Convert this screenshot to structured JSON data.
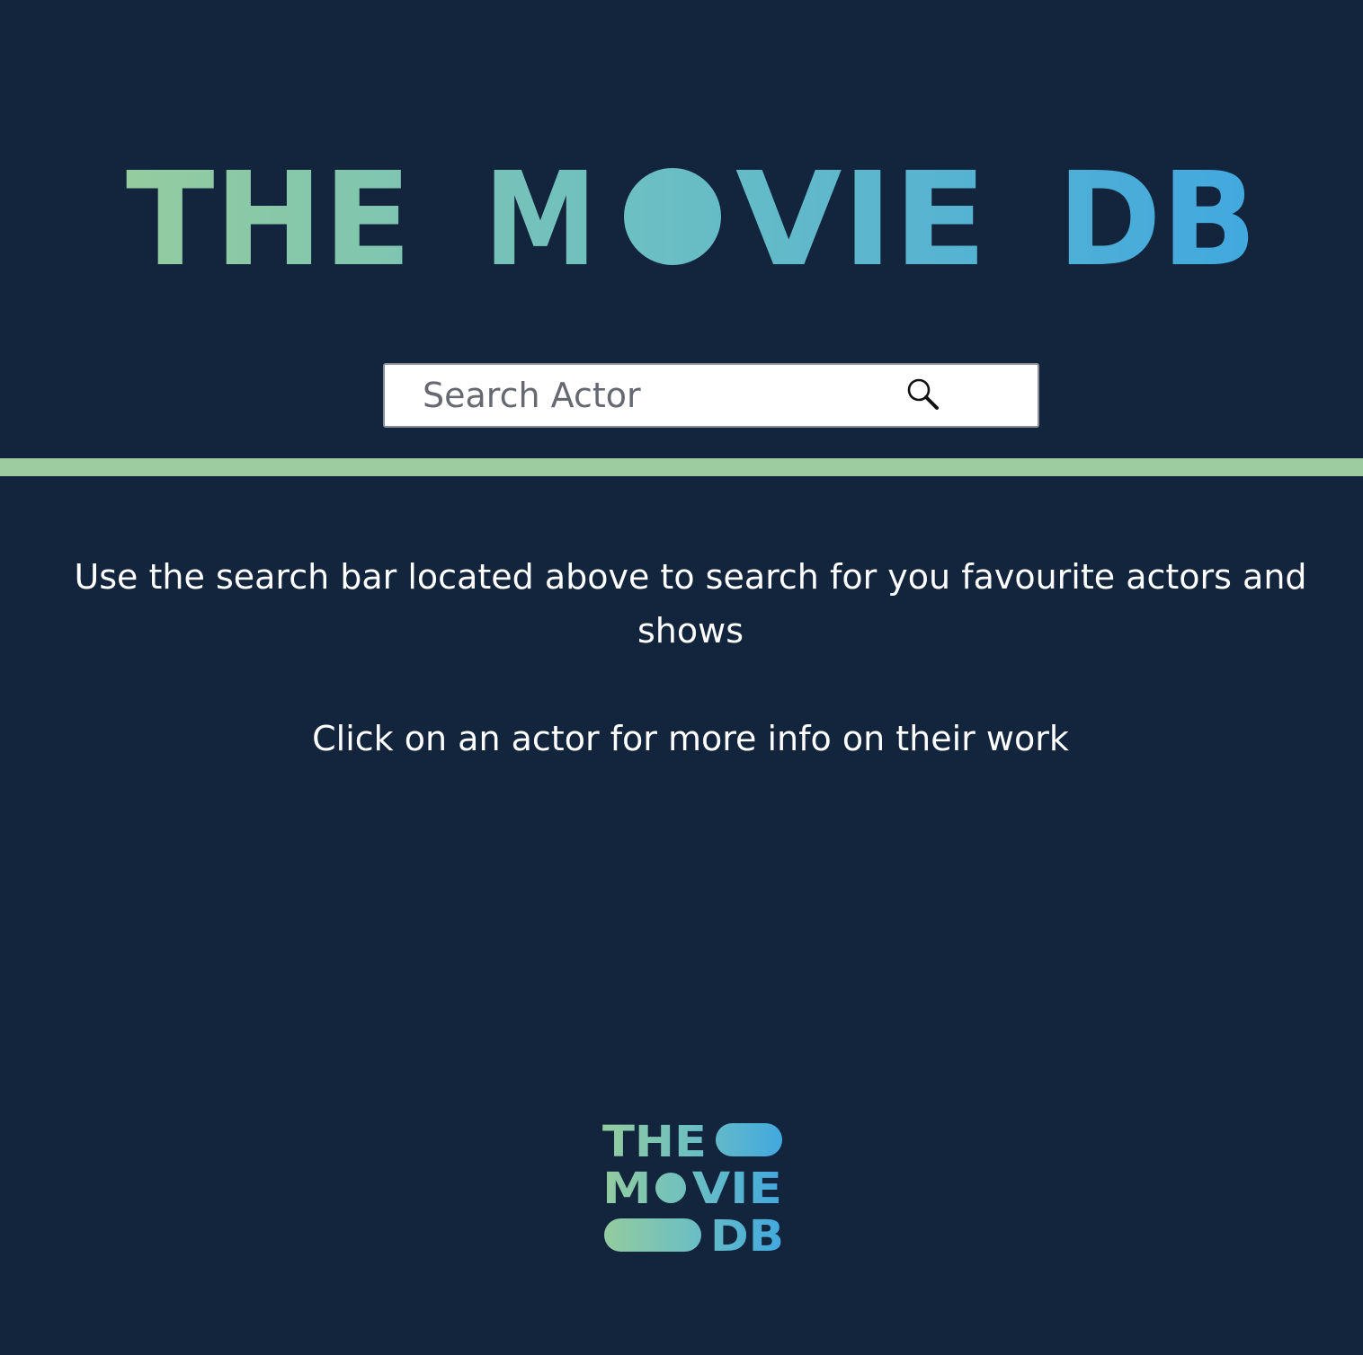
{
  "header": {
    "logo_text": "THE MOVIE DB",
    "logo_gradient": [
      "#92cba0",
      "#6cbfc4",
      "#43a9de"
    ]
  },
  "search": {
    "placeholder": "Search Actor",
    "value": "",
    "icon": "search-icon"
  },
  "divider": {
    "color": "#9ccc9f"
  },
  "main": {
    "instruction_1": "Use the search bar located above to search for you favourite actors and shows",
    "instruction_2": "Click on an actor for more info on their work"
  },
  "footer": {
    "logo_text": "THE MOVIE DB",
    "logo_line1": "THE",
    "logo_line2": "MOVIE",
    "logo_line3": "DB"
  },
  "colors": {
    "background": "#13243d",
    "text": "#ffffff",
    "accent_green": "#92cba0",
    "accent_blue": "#43a9de"
  }
}
